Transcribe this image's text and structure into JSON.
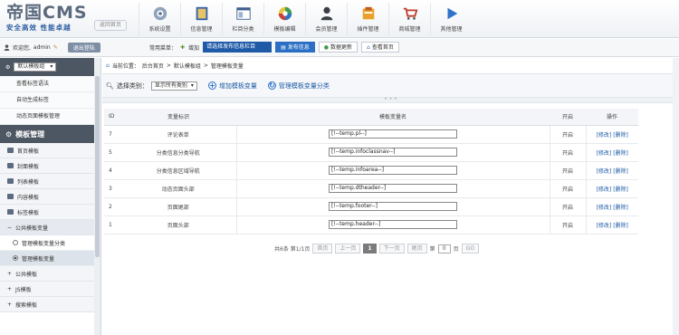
{
  "logo": {
    "title": "帝国CMS",
    "slogan": "安全高效 性能卓越"
  },
  "home_label": "返回首页",
  "nav": [
    {
      "label": "系统设置",
      "icon": "gear-icon"
    },
    {
      "label": "信息管理",
      "icon": "book-icon"
    },
    {
      "label": "栏目分类",
      "icon": "window-icon"
    },
    {
      "label": "模板编辑",
      "icon": "palette-icon"
    },
    {
      "label": "会员管理",
      "icon": "user-icon"
    },
    {
      "label": "插件管理",
      "icon": "plugin-icon"
    },
    {
      "label": "商城管理",
      "icon": "cart-icon"
    },
    {
      "label": "其他管理",
      "icon": "play-icon"
    }
  ],
  "user": {
    "greeting": "欢迎您,",
    "name": "admin",
    "logout": "退出登陆"
  },
  "quick": {
    "label": "常用菜单：",
    "add": "增加",
    "select": "请选择发布信息栏目",
    "publish": "发布信息",
    "update": "数据更新",
    "view_home": "查看首页"
  },
  "sidebar": {
    "group_select": "默认模板组",
    "top_items": [
      "查看标签语法",
      "自动生成标签",
      "动态页面模板管理"
    ],
    "section": "模板管理",
    "groups": [
      "首页模板",
      "封面模板",
      "列表模板",
      "内容模板",
      "标签模板",
      "公共模板变量"
    ],
    "leaves": [
      "管理模板变量分类",
      "管理模板变量"
    ],
    "more": [
      "公共模板",
      "JS模板",
      "搜索模板"
    ]
  },
  "crumb": {
    "label": "当前位置：",
    "items": [
      "后台首页",
      ">",
      "默认模板组",
      ">",
      "管理模板变量"
    ]
  },
  "toolbar": {
    "choose": "选择类别：",
    "option": "显示所有类别",
    "add": "增加模板变量",
    "manage": "管理模板变量分类"
  },
  "table": {
    "headers": [
      "ID",
      "变量标识",
      "模板变量名",
      "开启",
      "操作"
    ],
    "rows": [
      {
        "id": "7",
        "mark": "评论表单",
        "var": "[!--temp.pl--]",
        "on": "开启",
        "edit": "[修改]",
        "del": "[删除]"
      },
      {
        "id": "5",
        "mark": "分类信息分类导航",
        "var": "[!--temp.infoclassnav--]",
        "on": "开启",
        "edit": "[修改]",
        "del": "[删除]"
      },
      {
        "id": "4",
        "mark": "分类信息区域导航",
        "var": "[!--temp.infoarea--]",
        "on": "开启",
        "edit": "[修改]",
        "del": "[删除]"
      },
      {
        "id": "3",
        "mark": "动态页面头部",
        "var": "[!--temp.dtheader--]",
        "on": "开启",
        "edit": "[修改]",
        "del": "[删除]"
      },
      {
        "id": "2",
        "mark": "页面尾部",
        "var": "[!--temp.footer--]",
        "on": "开启",
        "edit": "[修改]",
        "del": "[删除]"
      },
      {
        "id": "1",
        "mark": "页面头部",
        "var": "[!--temp.header--]",
        "on": "开启",
        "edit": "[修改]",
        "del": "[删除]"
      }
    ]
  },
  "pager": {
    "summary": "共6条 第1/1页",
    "first": "首页",
    "prev": "上一页",
    "current": "1",
    "next": "下一页",
    "last": "尾页",
    "goto": "第",
    "page_value": "0",
    "unit": "页",
    "go": "GO"
  },
  "colors": {
    "accent": "#2a6fc4",
    "sidebar_head": "#4d5663"
  }
}
